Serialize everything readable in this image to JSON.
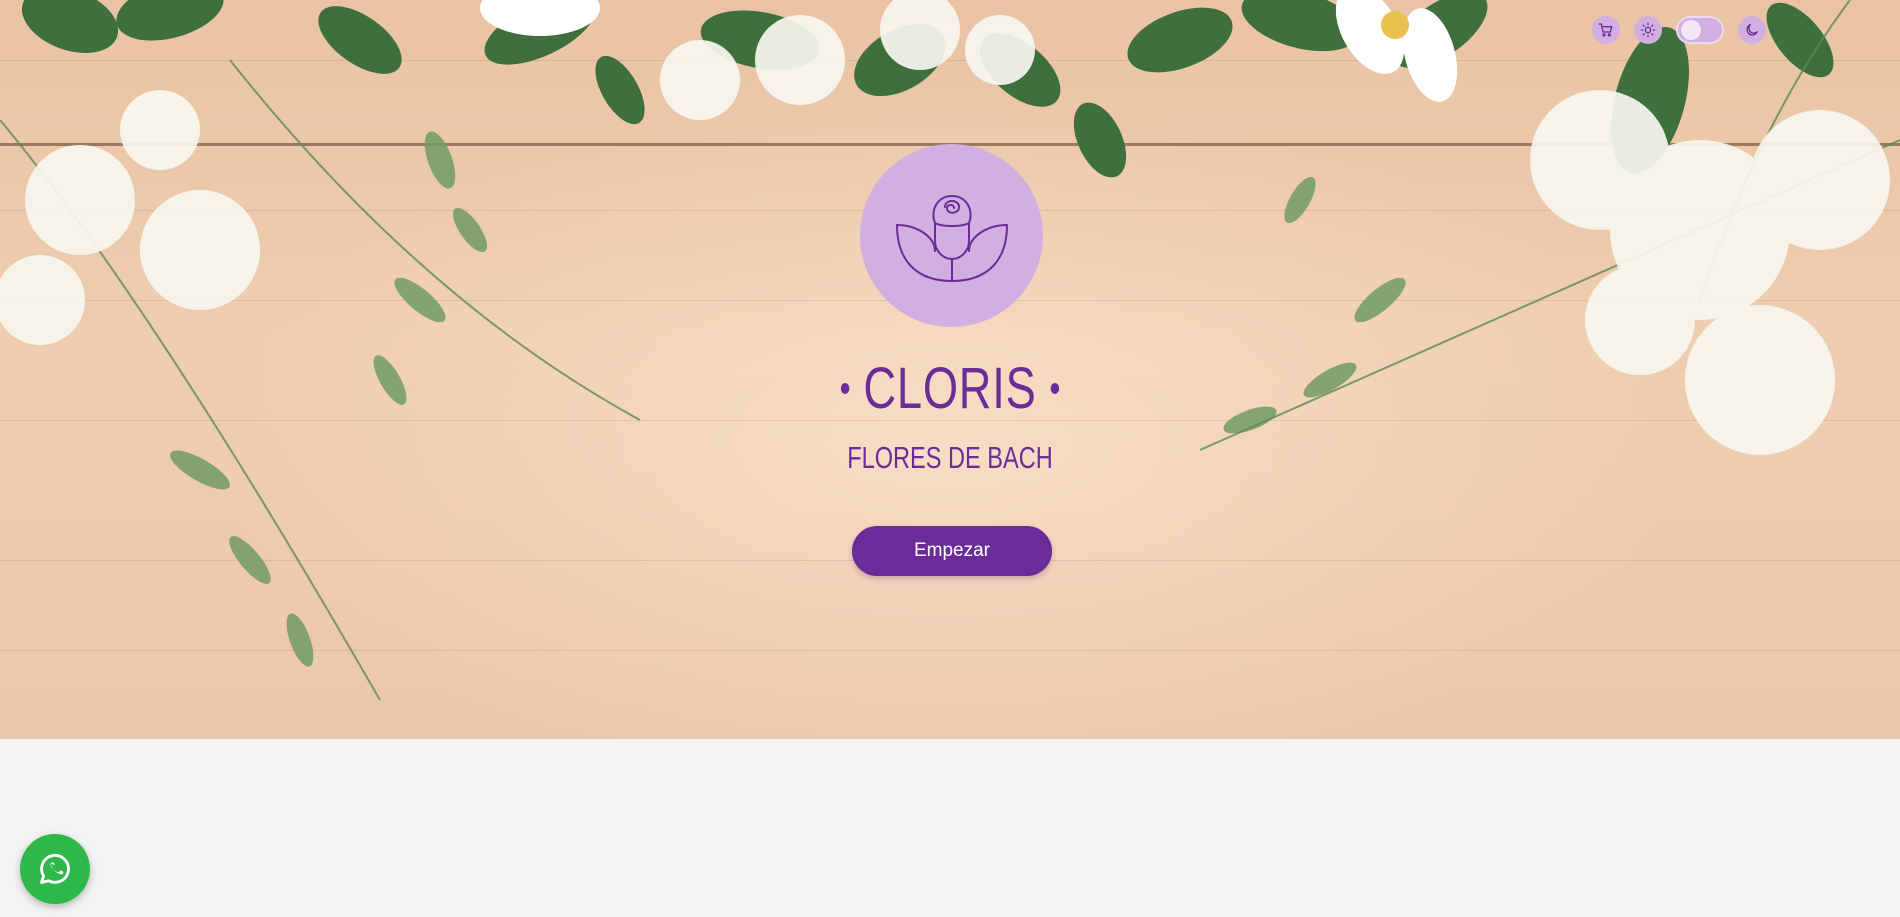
{
  "brand": {
    "name": "CLORIS",
    "subtitle": "FLORES DE BACH",
    "logo_icon": "rose-line-icon"
  },
  "hero": {
    "cta_label": "Empezar"
  },
  "topbar": {
    "icons": [
      "cart-icon",
      "sun-icon",
      "theme-toggle",
      "moon-icon"
    ],
    "theme_toggle_state": "light"
  },
  "floating": {
    "whatsapp_icon": "whatsapp-icon"
  },
  "colors": {
    "primary": "#6b2c99",
    "accent_light": "#d1afe1",
    "background": "#f4f3f3",
    "whatsapp": "#2fb84a"
  }
}
